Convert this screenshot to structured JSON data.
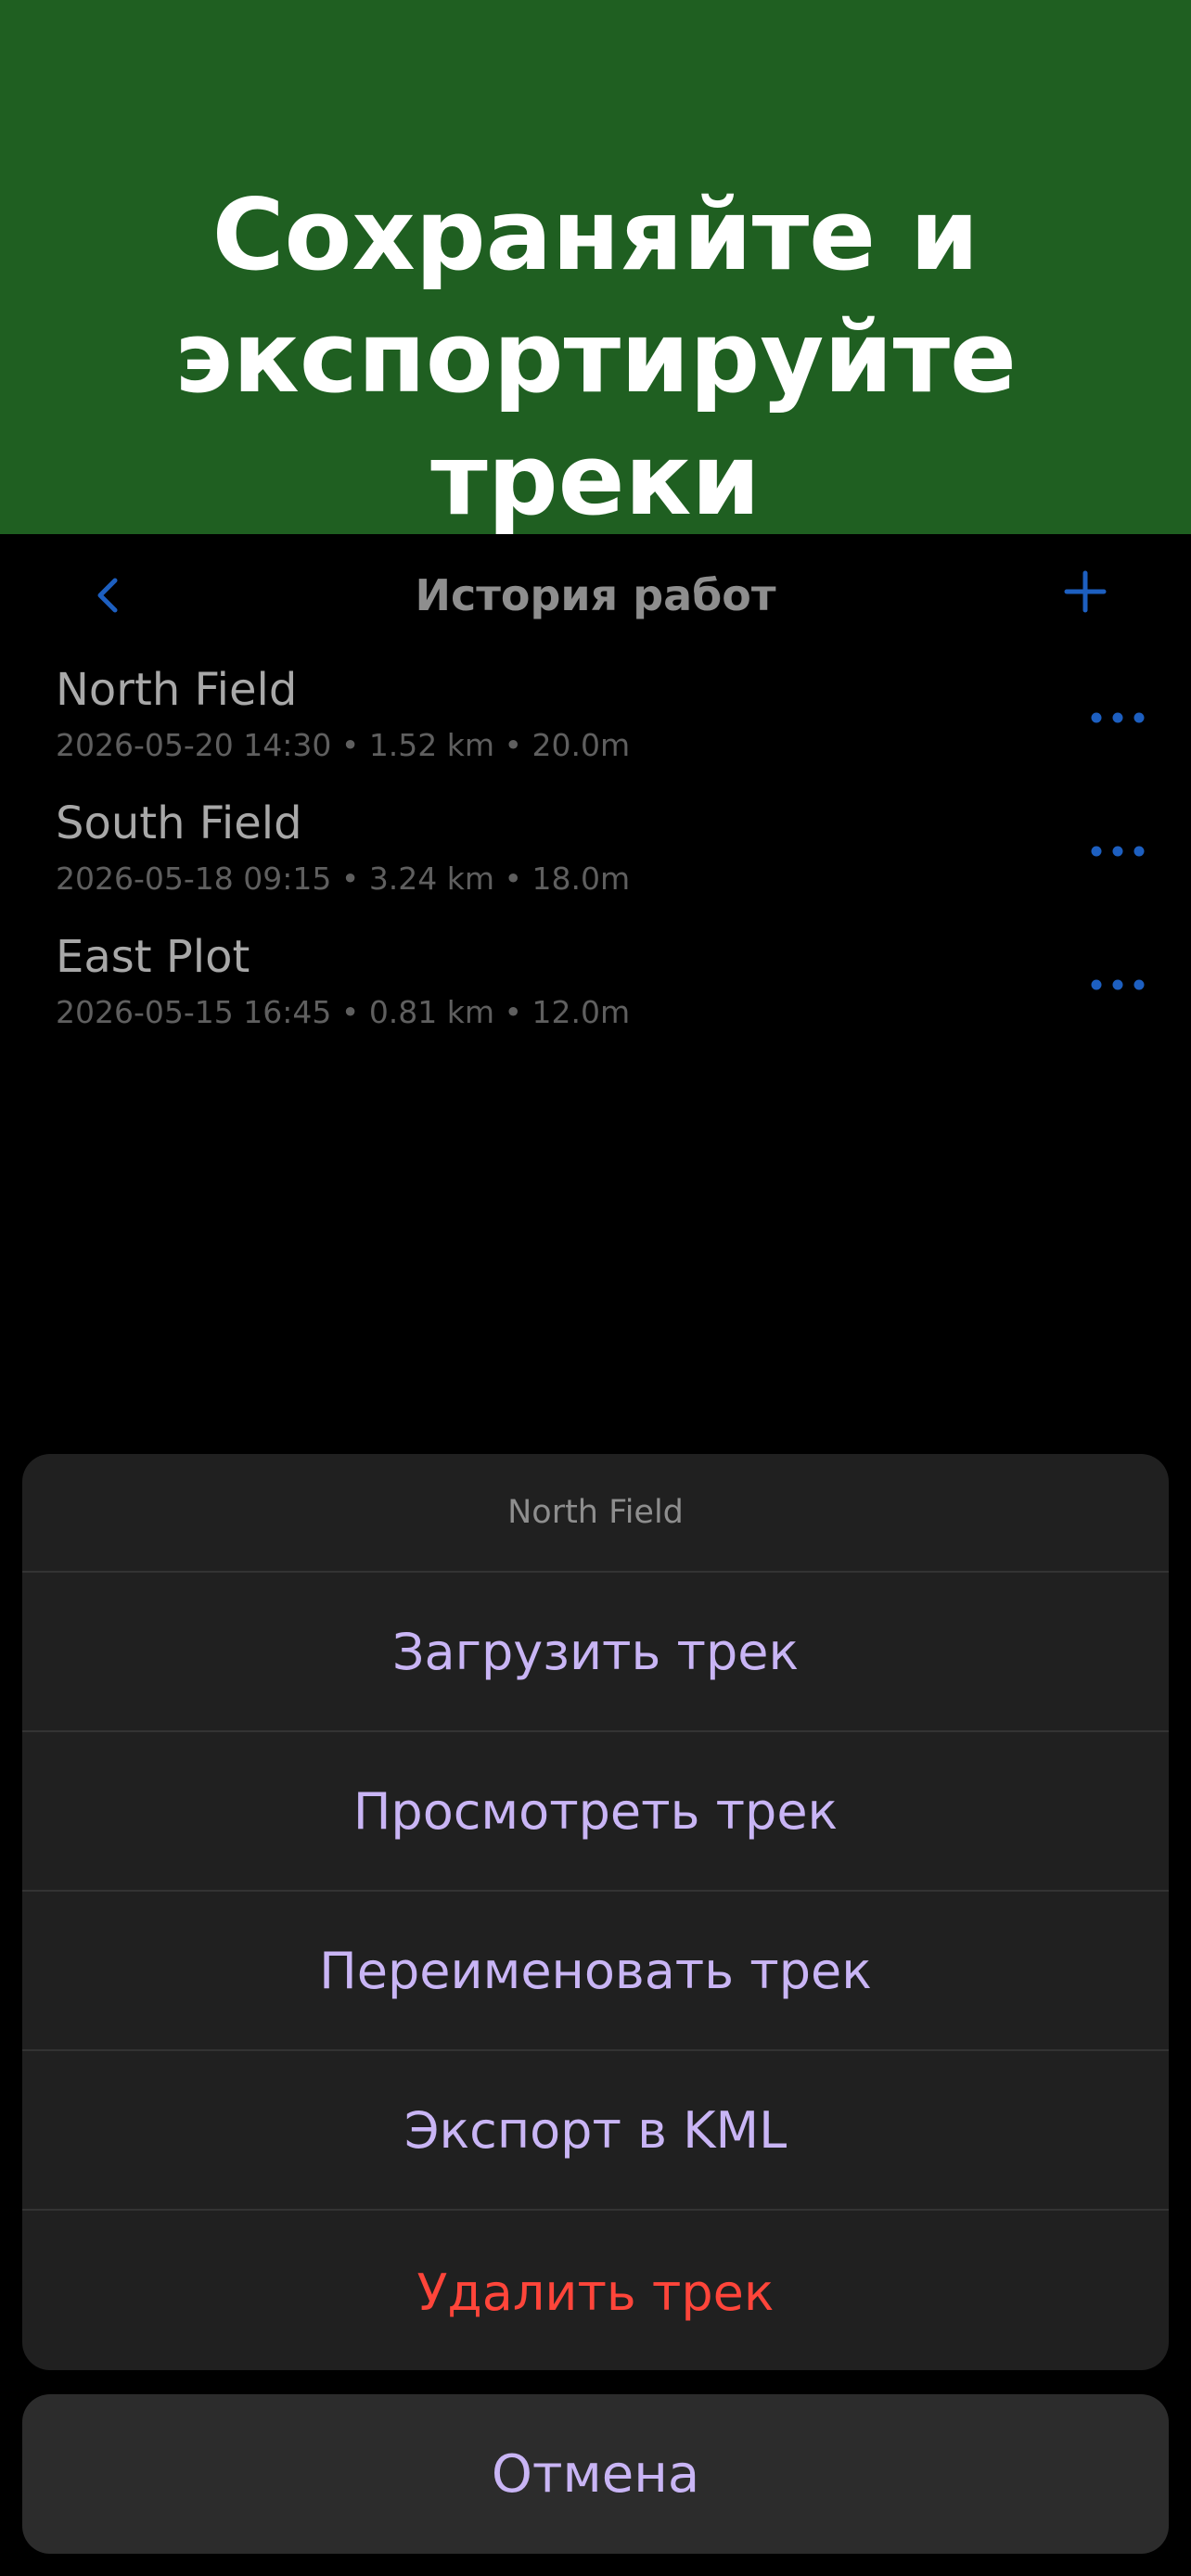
{
  "banner": {
    "title": "Сохраняйте и\nэкспортируйте\nтреки"
  },
  "nav": {
    "title": "История работ",
    "back_icon": "chevron-left-icon",
    "add_icon": "plus-icon"
  },
  "tracks": [
    {
      "name": "North Field",
      "meta": "2026-05-20 14:30 • 1.52 km • 20.0m"
    },
    {
      "name": "South Field",
      "meta": "2026-05-18 09:15 • 3.24 km • 18.0m"
    },
    {
      "name": "East Plot",
      "meta": "2026-05-15 16:45 • 0.81 km • 12.0m"
    }
  ],
  "action_sheet": {
    "title": "North Field",
    "actions": [
      {
        "label": "Загрузить трек"
      },
      {
        "label": "Просмотреть трек"
      },
      {
        "label": "Переименовать трек"
      },
      {
        "label": "Экспорт в KML"
      },
      {
        "label": "Удалить трек"
      }
    ],
    "cancel": "Отмена"
  },
  "colors": {
    "banner_bg": "#1f5f21",
    "accent_blue": "#1d5fc0",
    "action_text": "#c9b5f5",
    "destructive": "#ff453a"
  }
}
